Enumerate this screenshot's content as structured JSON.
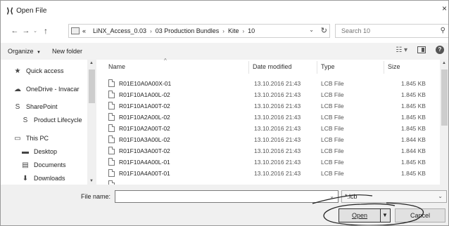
{
  "window": {
    "app_icon": "⟩⟨",
    "title": "Open File",
    "close_glyph": "×"
  },
  "nav": {
    "back_glyph": "←",
    "forward_glyph": "→",
    "recent_glyph": "⌄",
    "up_glyph": "↑",
    "overflow_glyph": "«",
    "separator_glyph": "›",
    "breadcrumbs": [
      "LiNX_Access_0.03",
      "03 Production Bundles",
      "Kite",
      "10"
    ],
    "dropdown_glyph": "⌄",
    "refresh_glyph": "↻",
    "search_placeholder": "Search 10",
    "search_glyph": "⚲"
  },
  "toolbar": {
    "organize_label": "Organize",
    "organize_caret": "▼",
    "new_folder_label": "New folder",
    "view_glyph": "☷ ▾",
    "help_glyph": "?"
  },
  "sidebar": {
    "items": [
      {
        "label": "Quick access",
        "icon": "star-icon",
        "glyph": "★"
      },
      {
        "label": "OneDrive - Invacar",
        "icon": "cloud-icon",
        "glyph": "☁"
      },
      {
        "label": "SharePoint",
        "icon": "sharepoint-icon",
        "glyph": "S"
      },
      {
        "label": "Product Lifecycle",
        "icon": "sharepoint-icon",
        "glyph": "S"
      },
      {
        "label": "This PC",
        "icon": "computer-icon",
        "glyph": "▭"
      },
      {
        "label": "Desktop",
        "icon": "desktop-icon",
        "glyph": "▬"
      },
      {
        "label": "Documents",
        "icon": "documents-icon",
        "glyph": "▤"
      },
      {
        "label": "Downloads",
        "icon": "downloads-icon",
        "glyph": "⬇"
      }
    ],
    "scroll_up": "▲",
    "scroll_down": "▼"
  },
  "columns": {
    "name": "Name",
    "date": "Date modified",
    "type": "Type",
    "size": "Size",
    "sort_glyph": "^"
  },
  "files": [
    {
      "name": "R01E10A0A00X-01",
      "date": "13.10.2016 21:43",
      "type": "LCB File",
      "size": "1.845 KB"
    },
    {
      "name": "R01F10A1A00L-02",
      "date": "13.10.2016 21:43",
      "type": "LCB File",
      "size": "1.845 KB"
    },
    {
      "name": "R01F10A1A00T-02",
      "date": "13.10.2016 21:43",
      "type": "LCB File",
      "size": "1.845 KB"
    },
    {
      "name": "R01F10A2A00L-02",
      "date": "13.10.2016 21:43",
      "type": "LCB File",
      "size": "1.845 KB"
    },
    {
      "name": "R01F10A2A00T-02",
      "date": "13.10.2016 21:43",
      "type": "LCB File",
      "size": "1.845 KB"
    },
    {
      "name": "R01F10A3A00L-02",
      "date": "13.10.2016 21:43",
      "type": "LCB File",
      "size": "1.844 KB"
    },
    {
      "name": "R01F10A3A00T-02",
      "date": "13.10.2016 21:43",
      "type": "LCB File",
      "size": "1.844 KB"
    },
    {
      "name": "R01F10A4A00L-01",
      "date": "13.10.2016 21:43",
      "type": "LCB File",
      "size": "1.845 KB"
    },
    {
      "name": "R01F10A4A00T-01",
      "date": "13.10.2016 21:43",
      "type": "LCB File",
      "size": "1.845 KB"
    }
  ],
  "bottom": {
    "file_name_label": "File name:",
    "file_name_value": "",
    "file_type_value": "*.lcb",
    "open_label": "Open",
    "open_caret": "▼",
    "cancel_label": "Cancel",
    "dropdown_glyph": "⌄"
  }
}
